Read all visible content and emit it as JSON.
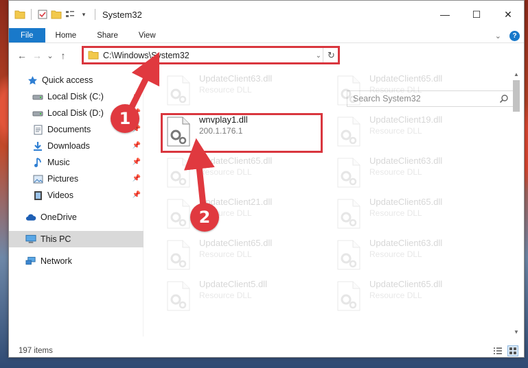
{
  "window": {
    "title": "System32",
    "controls": {
      "minimize": "—",
      "maximize": "☐",
      "close": "✕"
    }
  },
  "ribbon": {
    "tabs": [
      {
        "label": "File"
      },
      {
        "label": "Home"
      },
      {
        "label": "Share"
      },
      {
        "label": "View"
      }
    ]
  },
  "navbar": {
    "back": "←",
    "forward": "→",
    "recent": "⌄",
    "up": "↑",
    "address_path": "C:\\Windows\\System32",
    "search_placeholder": "Search System32"
  },
  "navpane": {
    "items": [
      {
        "label": "Quick access",
        "icon": "star-icon",
        "pinned": false
      },
      {
        "label": "Local Disk (C:)",
        "icon": "drive-icon",
        "pinned": true
      },
      {
        "label": "Local Disk (D:)",
        "icon": "drive-icon",
        "pinned": true
      },
      {
        "label": "Documents",
        "icon": "document-icon",
        "pinned": true
      },
      {
        "label": "Downloads",
        "icon": "download-icon",
        "pinned": true
      },
      {
        "label": "Music",
        "icon": "music-icon",
        "pinned": true
      },
      {
        "label": "Pictures",
        "icon": "picture-icon",
        "pinned": true
      },
      {
        "label": "Videos",
        "icon": "video-icon",
        "pinned": true
      },
      {
        "label": "OneDrive",
        "icon": "cloud-icon",
        "pinned": false
      },
      {
        "label": "This PC",
        "icon": "computer-icon",
        "pinned": false,
        "selected": true
      },
      {
        "label": "Network",
        "icon": "network-icon",
        "pinned": false
      }
    ]
  },
  "files": {
    "left": [
      {
        "name": "UpdateClient63.dll",
        "type": "Resource DLL",
        "faded": true
      },
      {
        "name": "wnvplay1.dll",
        "type": "200.1.176.1",
        "faded": false
      },
      {
        "name": "UpdateClient65.dll",
        "type": "Resource DLL",
        "faded": true
      },
      {
        "name": "UpdateClient21.dll",
        "type": "Resource DLL",
        "faded": true
      },
      {
        "name": "UpdateClient65.dll",
        "type": "Resource DLL",
        "faded": true
      },
      {
        "name": "UpdateClient5.dll",
        "type": "Resource DLL",
        "faded": true
      }
    ],
    "right": [
      {
        "name": "UpdateClient65.dll",
        "type": "Resource DLL",
        "faded": true
      },
      {
        "name": "UpdateClient19.dll",
        "type": "Resource DLL",
        "faded": true
      },
      {
        "name": "UpdateClient63.dll",
        "type": "Resource DLL",
        "faded": true
      },
      {
        "name": "UpdateClient65.dll",
        "type": "Resource DLL",
        "faded": true
      },
      {
        "name": "UpdateClient63.dll",
        "type": "Resource DLL",
        "faded": true
      },
      {
        "name": "UpdateClient65.dll",
        "type": "Resource DLL",
        "faded": true
      }
    ]
  },
  "status": {
    "item_count": "197 items"
  },
  "annotations": {
    "step1": "1",
    "step2": "2",
    "color": "#e0393f"
  },
  "colors": {
    "accent": "#1979ca",
    "highlight": "#d9363e"
  }
}
